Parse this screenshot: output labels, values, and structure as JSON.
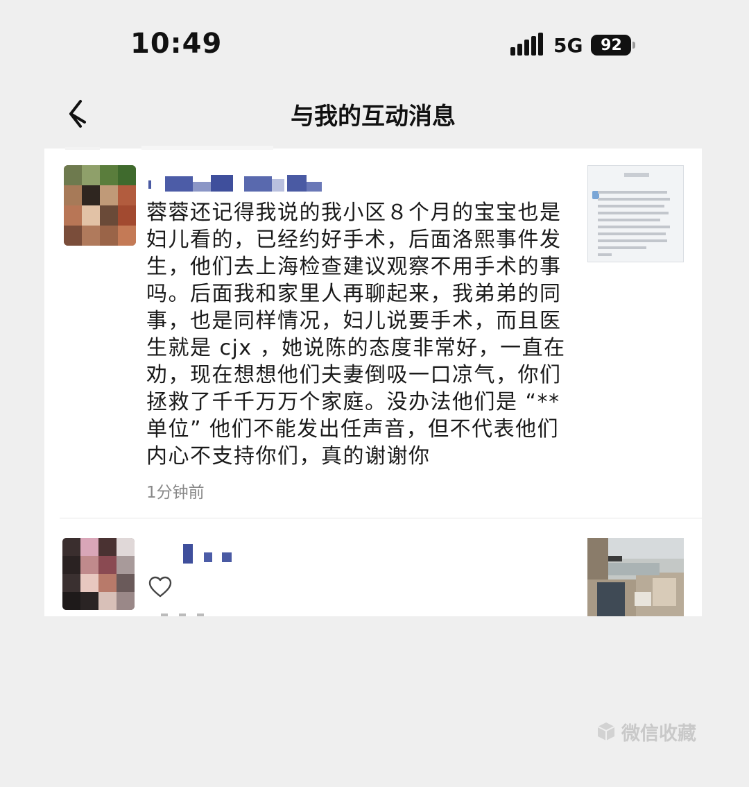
{
  "status_bar": {
    "time": "10:49",
    "network": "5G",
    "battery": "92"
  },
  "header": {
    "title": "与我的互动消息"
  },
  "messages": [
    {
      "text": "蓉蓉还记得我说的我小区８个月的宝宝也是妇儿看的，已经约好手术，后面洛熙事件发生，他们去上海检查建议观察不用手术的事吗。后面我和家里人再聊起来，我弟弟的同事，也是同样情况，妇儿说要手术，而且医生就是 cjx ，她说陈的态度非常好，一直在劝，现在想想他们夫妻倒吸一口凉气，你们拯救了千千万万个家庭。没办法他们是 “** 单位” 他们不能发出任声音，但不代表他们内心不支持你们，真的谢谢你",
      "time": "1分钟前"
    }
  ],
  "watermark": {
    "text": "微信收藏"
  },
  "colors": {
    "background": "#efefef",
    "card": "#ffffff",
    "text": "#1a1a1a",
    "muted": "#888888",
    "pixelated_name": "#4a5aa3"
  },
  "icons": [
    "back-arrow-icon",
    "heart-icon",
    "cube-icon",
    "signal-icon",
    "battery-icon"
  ]
}
